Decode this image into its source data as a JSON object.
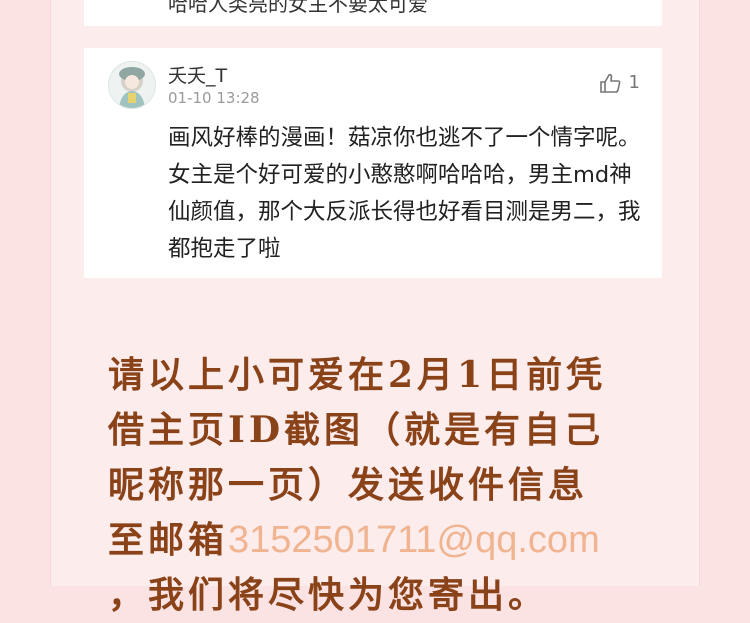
{
  "previous_comment": {
    "text_fragment": "哈哈人类亮的女主不要太可爱"
  },
  "comment": {
    "username": "夭夭_T",
    "timestamp": "01-10 13:28",
    "likes": "1",
    "text": "画风好棒的漫画！菇凉你也逃不了一个情字呢。女主是个好可爱的小憨憨啊哈哈哈，男主md神仙颜值，那个大反派长得也好看目测是男二，我都抱走了啦",
    "icons": {
      "avatar": "avatar-illustration",
      "like": "thumbs-up-icon"
    }
  },
  "notice": {
    "line1": "请以上小可爱在2月1日前凭",
    "line2": "借主页ID截图（就是有自己",
    "line3": "昵称那一页）发送收件信息",
    "line4_prefix": "至邮箱",
    "email": "3152501711@qq.com",
    "line5": "，我们将尽快为您寄出。"
  },
  "colors": {
    "background": "#fbe3e3",
    "panel": "#fcecec",
    "notice_text": "#8a4219",
    "email_text": "#f0b490"
  }
}
